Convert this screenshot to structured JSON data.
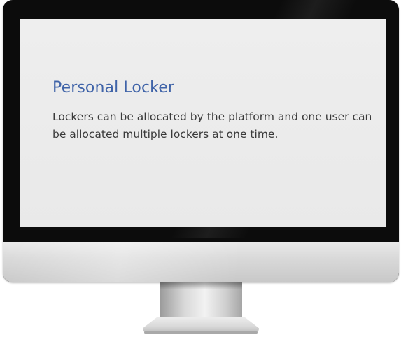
{
  "screen": {
    "title": "Personal Locker",
    "description": "Lockers can be allocated by the platform and one user can be allocated multiple lockers at one time."
  },
  "colors": {
    "title": "#3f63a8",
    "body_text": "#3a3a3a",
    "screen_background": "#ececec",
    "bezel": "#0c0c0c"
  }
}
